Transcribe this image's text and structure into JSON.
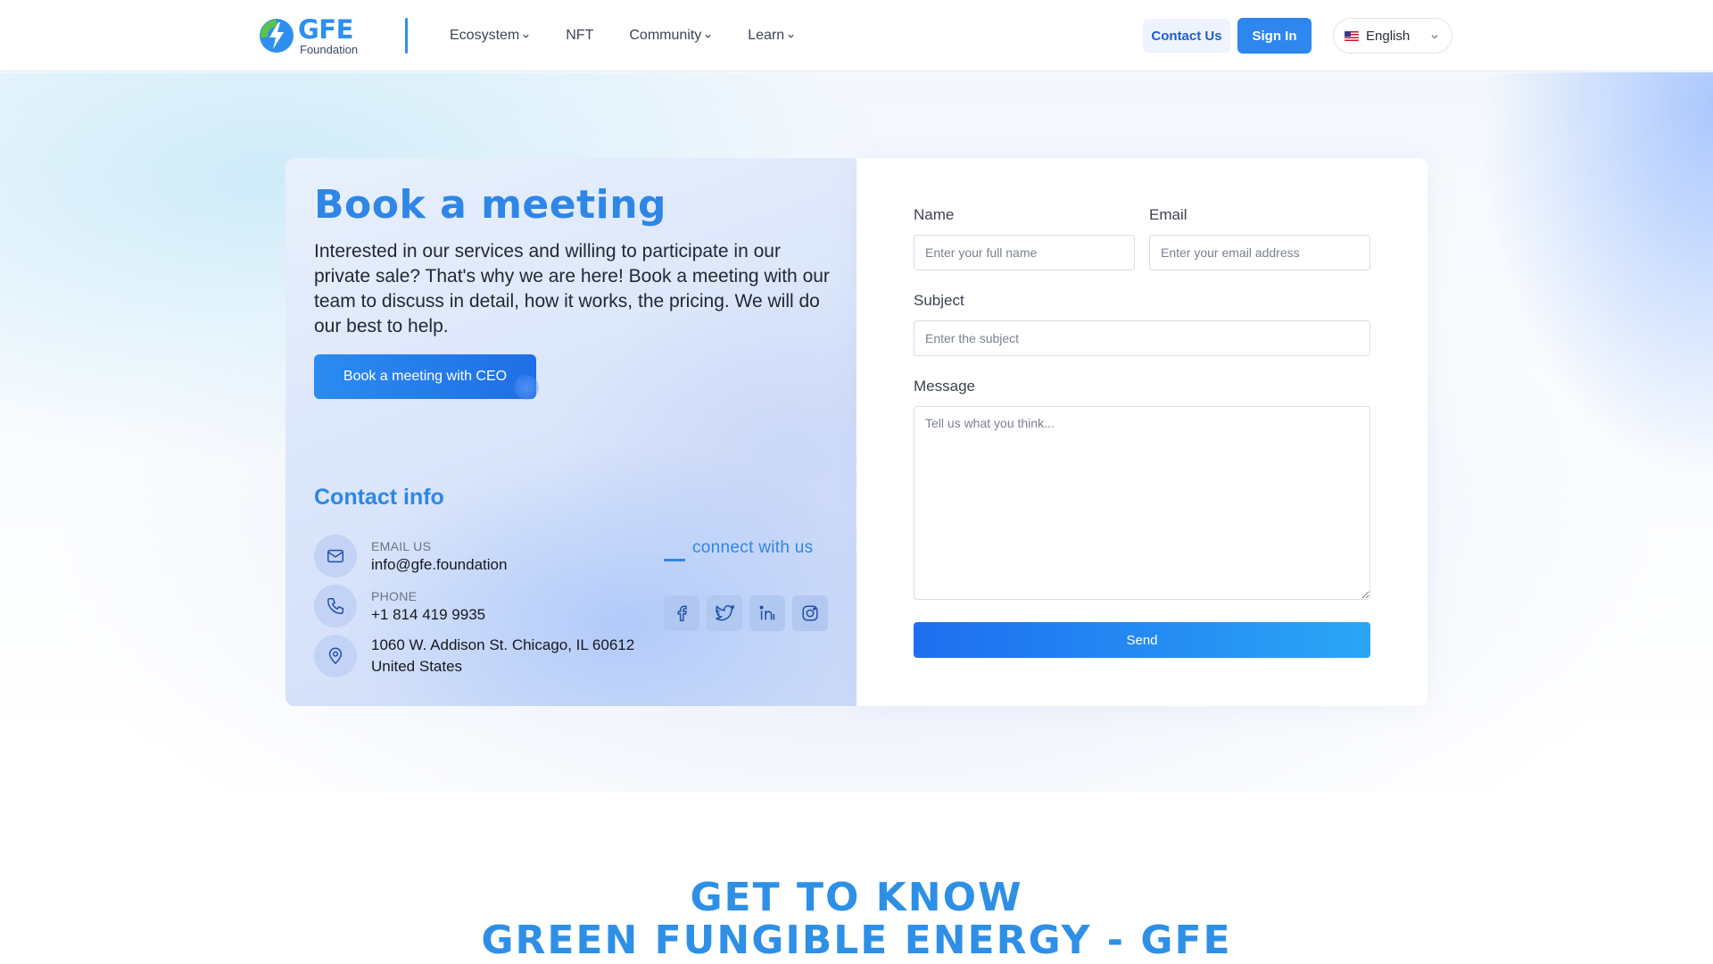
{
  "brand": {
    "name": "GFE",
    "sub": "Foundation",
    "logo_icon": "lightning-leaf-logo-icon",
    "primary_color": "#2e86e6"
  },
  "nav": {
    "items": [
      {
        "label": "Ecosystem",
        "has_dropdown": true
      },
      {
        "label": "NFT",
        "has_dropdown": false
      },
      {
        "label": "Community",
        "has_dropdown": true
      },
      {
        "label": "Learn",
        "has_dropdown": true
      }
    ]
  },
  "header": {
    "contact_label": "Contact Us",
    "signin_label": "Sign In",
    "language": {
      "label": "English",
      "flag_icon": "us-flag-icon"
    }
  },
  "meeting": {
    "title": "Book a meeting",
    "description": "Interested in our services and willing to participate in our private sale? That's why we are here! Book a meeting with our team to discuss in detail, how it works, the pricing. We will do our best to help.",
    "button_label": "Book a meeting with CEO"
  },
  "contact": {
    "title": "Contact info",
    "email": {
      "label": "EMAIL US",
      "value": "info@gfe.foundation",
      "icon": "mail-icon"
    },
    "phone": {
      "label": "PHONE",
      "value": "+1 814 419 9935",
      "icon": "phone-icon"
    },
    "address": {
      "line1": "1060 W. Addison St. Chicago, IL 60612",
      "line2": "United States",
      "icon": "location-pin-icon"
    },
    "connect_label": "connect with us",
    "socials": [
      "facebook-icon",
      "twitter-icon",
      "linkedin-icon",
      "instagram-icon"
    ]
  },
  "form": {
    "name_label": "Name",
    "name_placeholder": "Enter your full name",
    "email_label": "Email",
    "email_placeholder": "Enter your email address",
    "subject_label": "Subject",
    "subject_placeholder": "Enter the subject",
    "message_label": "Message",
    "message_placeholder": "Tell us what you think...",
    "send_label": "Send"
  },
  "bottom": {
    "line1": "GET TO KNOW",
    "line2": "GREEN FUNGIBLE ENERGY - GFE"
  }
}
